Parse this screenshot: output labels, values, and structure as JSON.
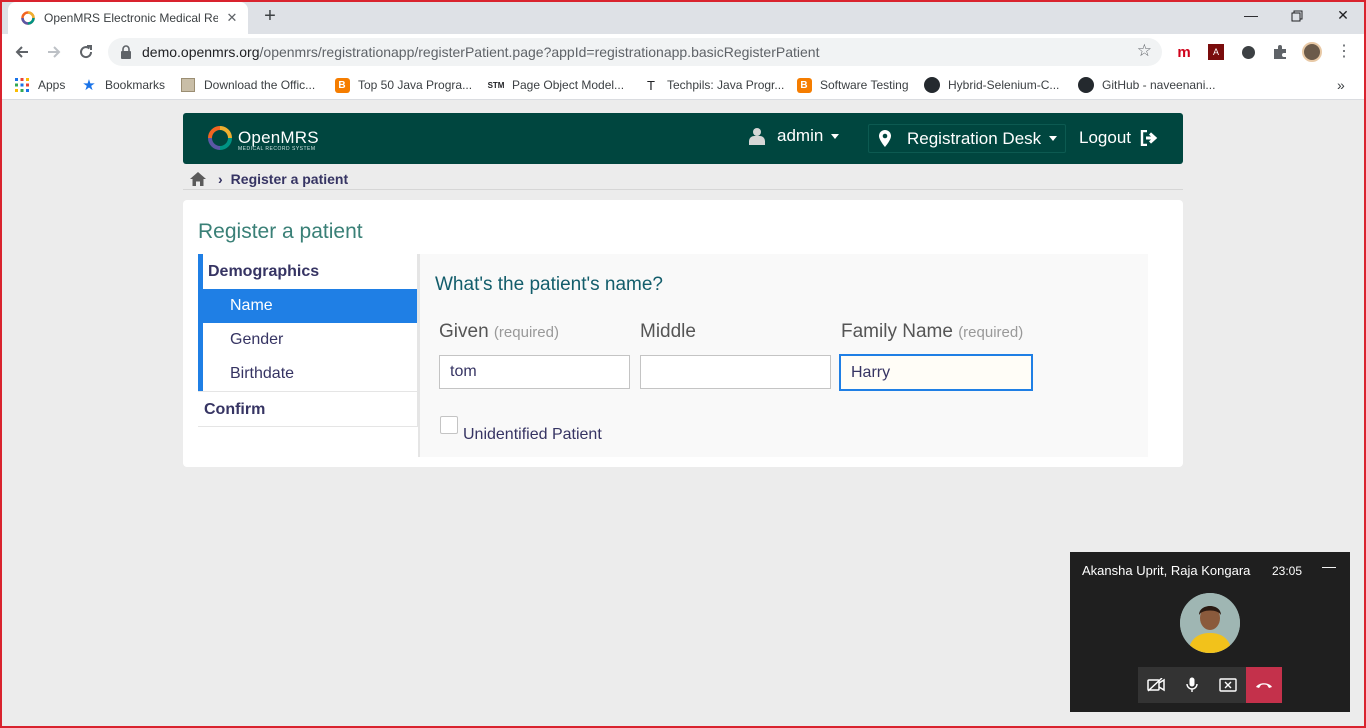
{
  "browser": {
    "tab_title": "OpenMRS Electronic Medical Rec",
    "url_host": "demo.openmrs.org",
    "url_path": "/openmrs/registrationapp/registerPatient.page?appId=registrationapp.basicRegisterPatient",
    "bookmarks": [
      {
        "label": "Apps",
        "icon": "apps-grid-icon"
      },
      {
        "label": "Bookmarks",
        "icon": "star-icon"
      },
      {
        "label": "Download the Offic...",
        "icon": "page-icon"
      },
      {
        "label": "Top 50 Java Progra...",
        "icon": "blogger-icon"
      },
      {
        "label": "Page Object Model...",
        "icon": "stm-icon"
      },
      {
        "label": "Techpils: Java Progr...",
        "icon": "t-icon"
      },
      {
        "label": "Software Testing",
        "icon": "blogger-icon"
      },
      {
        "label": "Hybrid-Selenium-C...",
        "icon": "github-icon"
      },
      {
        "label": "GitHub - naveenani...",
        "icon": "github-icon"
      }
    ]
  },
  "header": {
    "logo_text": "OpenMRS",
    "logo_sub": "MEDICAL RECORD SYSTEM",
    "user": "admin",
    "location": "Registration Desk",
    "logout": "Logout"
  },
  "breadcrumb": {
    "current": "Register a patient"
  },
  "page": {
    "title": "Register a patient",
    "nav": {
      "section_demographics": "Demographics",
      "items": [
        "Name",
        "Gender",
        "Birthdate"
      ],
      "section_confirm": "Confirm",
      "active_item": "Name"
    },
    "question": "What's the patient's name?",
    "fields": {
      "given_label": "Given",
      "given_req": "(required)",
      "given_value": "tom",
      "middle_label": "Middle",
      "middle_value": "",
      "family_label": "Family Name",
      "family_req": "(required)",
      "family_value": "Harry"
    },
    "unidentified_label": "Unidentified Patient",
    "unidentified_checked": false
  },
  "call": {
    "names": "Akansha Uprit, Raja Kongara",
    "time": "23:05",
    "minimize": "—"
  },
  "colors": {
    "header_bg": "#00463f",
    "active_nav": "#1f7fe5",
    "title_teal": "#3a8077",
    "hangup": "#c4314b"
  }
}
